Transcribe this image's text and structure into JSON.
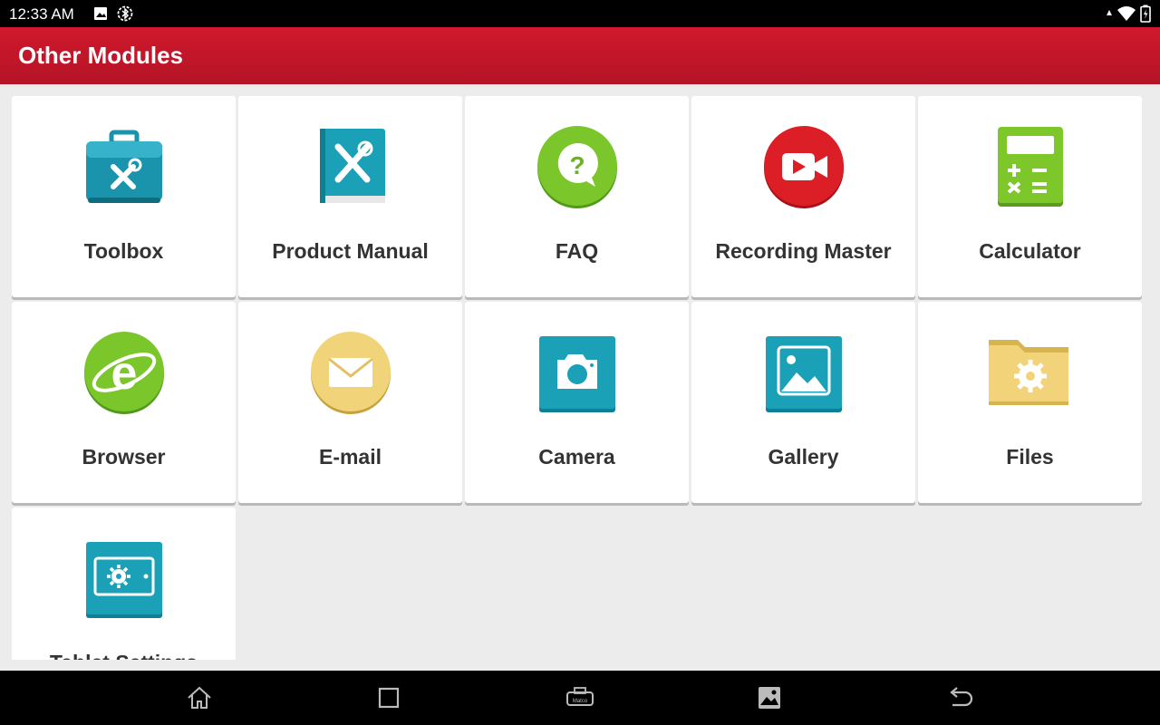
{
  "status_bar": {
    "time": "12:33 AM",
    "left_icons": [
      "image-notification-icon",
      "bluetooth-settings-icon"
    ],
    "right_icons": [
      "signal-icon",
      "wifi-icon",
      "battery-icon"
    ]
  },
  "app_bar": {
    "title": "Other Modules",
    "color": "#c8192c"
  },
  "modules": [
    {
      "label": "Toolbox",
      "icon": "toolbox-icon"
    },
    {
      "label": "Product Manual",
      "icon": "product-manual-icon"
    },
    {
      "label": "FAQ",
      "icon": "faq-icon"
    },
    {
      "label": "Recording Master",
      "icon": "recording-master-icon"
    },
    {
      "label": "Calculator",
      "icon": "calculator-icon"
    },
    {
      "label": "Browser",
      "icon": "browser-icon"
    },
    {
      "label": "E-mail",
      "icon": "email-icon"
    },
    {
      "label": "Camera",
      "icon": "camera-icon"
    },
    {
      "label": "Gallery",
      "icon": "gallery-icon"
    },
    {
      "label": "Files",
      "icon": "files-icon"
    },
    {
      "label": "Tablet Settings",
      "icon": "tablet-settings-icon"
    }
  ],
  "nav_bar": {
    "buttons": [
      "home-icon",
      "recent-apps-icon",
      "matco-vci-icon",
      "screenshot-icon",
      "back-icon"
    ],
    "vci_text": "Matco"
  }
}
